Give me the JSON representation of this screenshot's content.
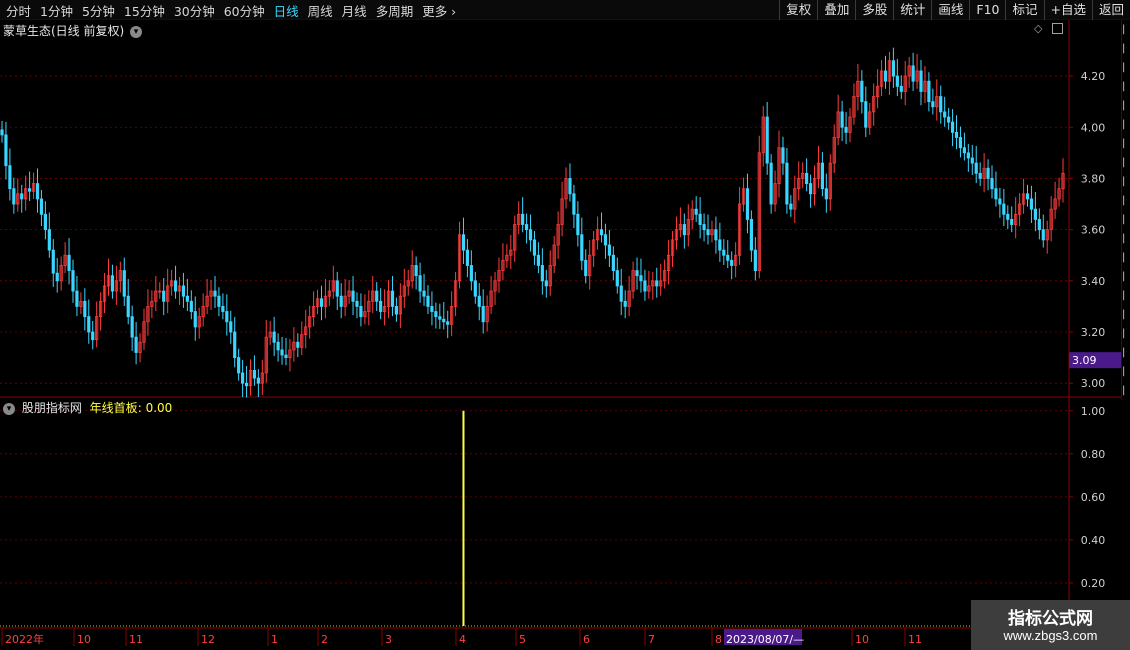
{
  "toolbar": {
    "periods": [
      "分时",
      "1分钟",
      "5分钟",
      "15分钟",
      "30分钟",
      "60分钟",
      "日线",
      "周线",
      "月线",
      "多周期",
      "更多"
    ],
    "active_period": "日线",
    "tools": [
      "复权",
      "叠加",
      "多股",
      "统计",
      "画线",
      "F10",
      "标记",
      "+自选",
      "返回"
    ]
  },
  "main_panel": {
    "title": "蒙草生态(日线 前复权)",
    "price_axis_ticks": [
      "4.20",
      "4.00",
      "3.80",
      "3.60",
      "3.40",
      "3.20",
      "3.00"
    ],
    "current_price": "3.09",
    "current_price_color": "#4a1a8a"
  },
  "indicator_panel": {
    "source": "股朋指标网",
    "name": "年线首板",
    "value": "0.00",
    "name_color": "#ffff40",
    "axis_ticks": [
      "1.00",
      "0.80",
      "0.60",
      "0.40",
      "0.20"
    ]
  },
  "time_axis": {
    "labels": [
      "2022年",
      "10",
      "11",
      "12",
      "1",
      "2",
      "3",
      "4",
      "5",
      "6",
      "7",
      "8",
      "10",
      "11"
    ],
    "cursor_date": "2023/08/07/—"
  },
  "watermark": {
    "line1": "指标公式网",
    "line2": "www.zbgs3.com"
  },
  "colors": {
    "up": "#ff3c3c",
    "down": "#3ad6ff",
    "grid": "#7a0000",
    "signal": "#ffff40"
  },
  "chart_data": {
    "type": "candlestick",
    "title": "蒙草生态(日线 前复权)",
    "y_range": [
      2.95,
      4.38
    ],
    "closes": [
      3.97,
      3.85,
      3.76,
      3.7,
      3.74,
      3.72,
      3.76,
      3.75,
      3.78,
      3.72,
      3.66,
      3.6,
      3.52,
      3.43,
      3.4,
      3.46,
      3.5,
      3.44,
      3.36,
      3.3,
      3.32,
      3.26,
      3.2,
      3.17,
      3.26,
      3.32,
      3.38,
      3.42,
      3.36,
      3.4,
      3.44,
      3.34,
      3.26,
      3.18,
      3.12,
      3.16,
      3.24,
      3.3,
      3.32,
      3.36,
      3.36,
      3.32,
      3.38,
      3.4,
      3.36,
      3.38,
      3.34,
      3.32,
      3.28,
      3.22,
      3.26,
      3.3,
      3.34,
      3.36,
      3.34,
      3.3,
      3.28,
      3.24,
      3.2,
      3.1,
      3.04,
      3.0,
      2.99,
      3.05,
      3.02,
      3.0,
      3.04,
      3.18,
      3.2,
      3.16,
      3.13,
      3.11,
      3.1,
      3.13,
      3.16,
      3.14,
      3.19,
      3.22,
      3.26,
      3.3,
      3.33,
      3.3,
      3.34,
      3.36,
      3.4,
      3.34,
      3.3,
      3.34,
      3.36,
      3.32,
      3.3,
      3.26,
      3.28,
      3.32,
      3.36,
      3.32,
      3.28,
      3.3,
      3.36,
      3.3,
      3.27,
      3.34,
      3.38,
      3.4,
      3.46,
      3.42,
      3.36,
      3.34,
      3.3,
      3.28,
      3.26,
      3.25,
      3.24,
      3.23,
      3.3,
      3.4,
      3.58,
      3.52,
      3.46,
      3.4,
      3.34,
      3.3,
      3.24,
      3.3,
      3.36,
      3.4,
      3.44,
      3.48,
      3.5,
      3.52,
      3.62,
      3.66,
      3.62,
      3.6,
      3.56,
      3.5,
      3.46,
      3.4,
      3.38,
      3.46,
      3.54,
      3.62,
      3.72,
      3.8,
      3.74,
      3.66,
      3.58,
      3.48,
      3.42,
      3.5,
      3.56,
      3.6,
      3.58,
      3.54,
      3.5,
      3.44,
      3.38,
      3.32,
      3.3,
      3.36,
      3.44,
      3.42,
      3.4,
      3.36,
      3.38,
      3.4,
      3.38,
      3.4,
      3.44,
      3.5,
      3.56,
      3.6,
      3.62,
      3.58,
      3.64,
      3.68,
      3.66,
      3.62,
      3.6,
      3.58,
      3.6,
      3.56,
      3.52,
      3.5,
      3.48,
      3.46,
      3.5,
      3.7,
      3.76,
      3.64,
      3.52,
      3.44,
      3.9,
      4.04,
      3.86,
      3.7,
      3.78,
      3.92,
      3.86,
      3.7,
      3.68,
      3.76,
      3.8,
      3.82,
      3.78,
      3.74,
      3.8,
      3.86,
      3.76,
      3.72,
      3.86,
      3.96,
      4.06,
      4.0,
      3.98,
      4.04,
      4.12,
      4.18,
      4.1,
      4.0,
      4.06,
      4.12,
      4.16,
      4.22,
      4.18,
      4.26,
      4.2,
      4.16,
      4.14,
      4.2,
      4.24,
      4.18,
      4.22,
      4.14,
      4.18,
      4.1,
      4.08,
      4.12,
      4.06,
      4.04,
      4.02,
      3.98,
      3.96,
      3.92,
      3.9,
      3.88,
      3.86,
      3.82,
      3.8,
      3.84,
      3.8,
      3.76,
      3.72,
      3.7,
      3.66,
      3.64,
      3.62,
      3.66,
      3.7,
      3.74,
      3.72,
      3.68,
      3.64,
      3.6,
      3.56,
      3.6,
      3.68,
      3.72,
      3.76,
      3.82
    ]
  },
  "indicator_data": {
    "type": "signal-bars",
    "y_range": [
      0,
      1.05
    ],
    "signal_index": 117,
    "signal_value": 1.0
  }
}
